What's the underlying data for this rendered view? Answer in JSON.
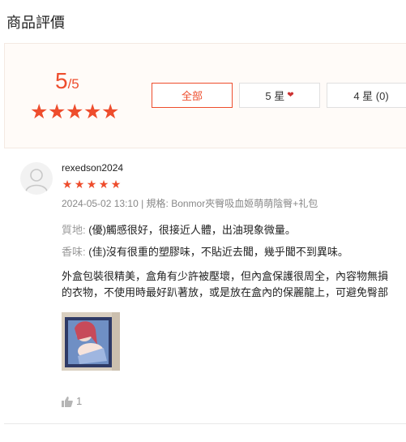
{
  "section": {
    "title": "商品評價"
  },
  "summary": {
    "avg_score": "5",
    "avg_max": "/5",
    "filters": [
      {
        "label": "全部",
        "active": true
      },
      {
        "label": "5 星",
        "suffix": "❤"
      },
      {
        "label": "4 星 (0)"
      }
    ]
  },
  "review": {
    "username": "rexedson2024",
    "rating": 5,
    "meta": "2024-05-02 13:10 | 規格: Bonmor夾臀吸血姬萌萌陰臀+礼包",
    "attrs": [
      {
        "key": "質地:",
        "value": " (優)觸感很好，很接近人體，出油現象微量。"
      },
      {
        "key": "香味:",
        "value": " (佳)沒有很重的塑膠味，不貼近去聞，幾乎聞不到異味。"
      }
    ],
    "comment_lines": [
      "外盒包裝很精美，盒角有少許被壓壞，但內盒保護很周全，內容物無損",
      "的衣物，不使用時最好趴著放，或是放在盒內的保麗龍上，可避免臀部"
    ],
    "likes": "1"
  },
  "colors": {
    "accent": "#ee4d2d",
    "summary_bg": "#fffbf8"
  },
  "icons": {
    "rating": "star-icon",
    "avatar": "user-icon",
    "like": "thumbs-up-icon"
  }
}
